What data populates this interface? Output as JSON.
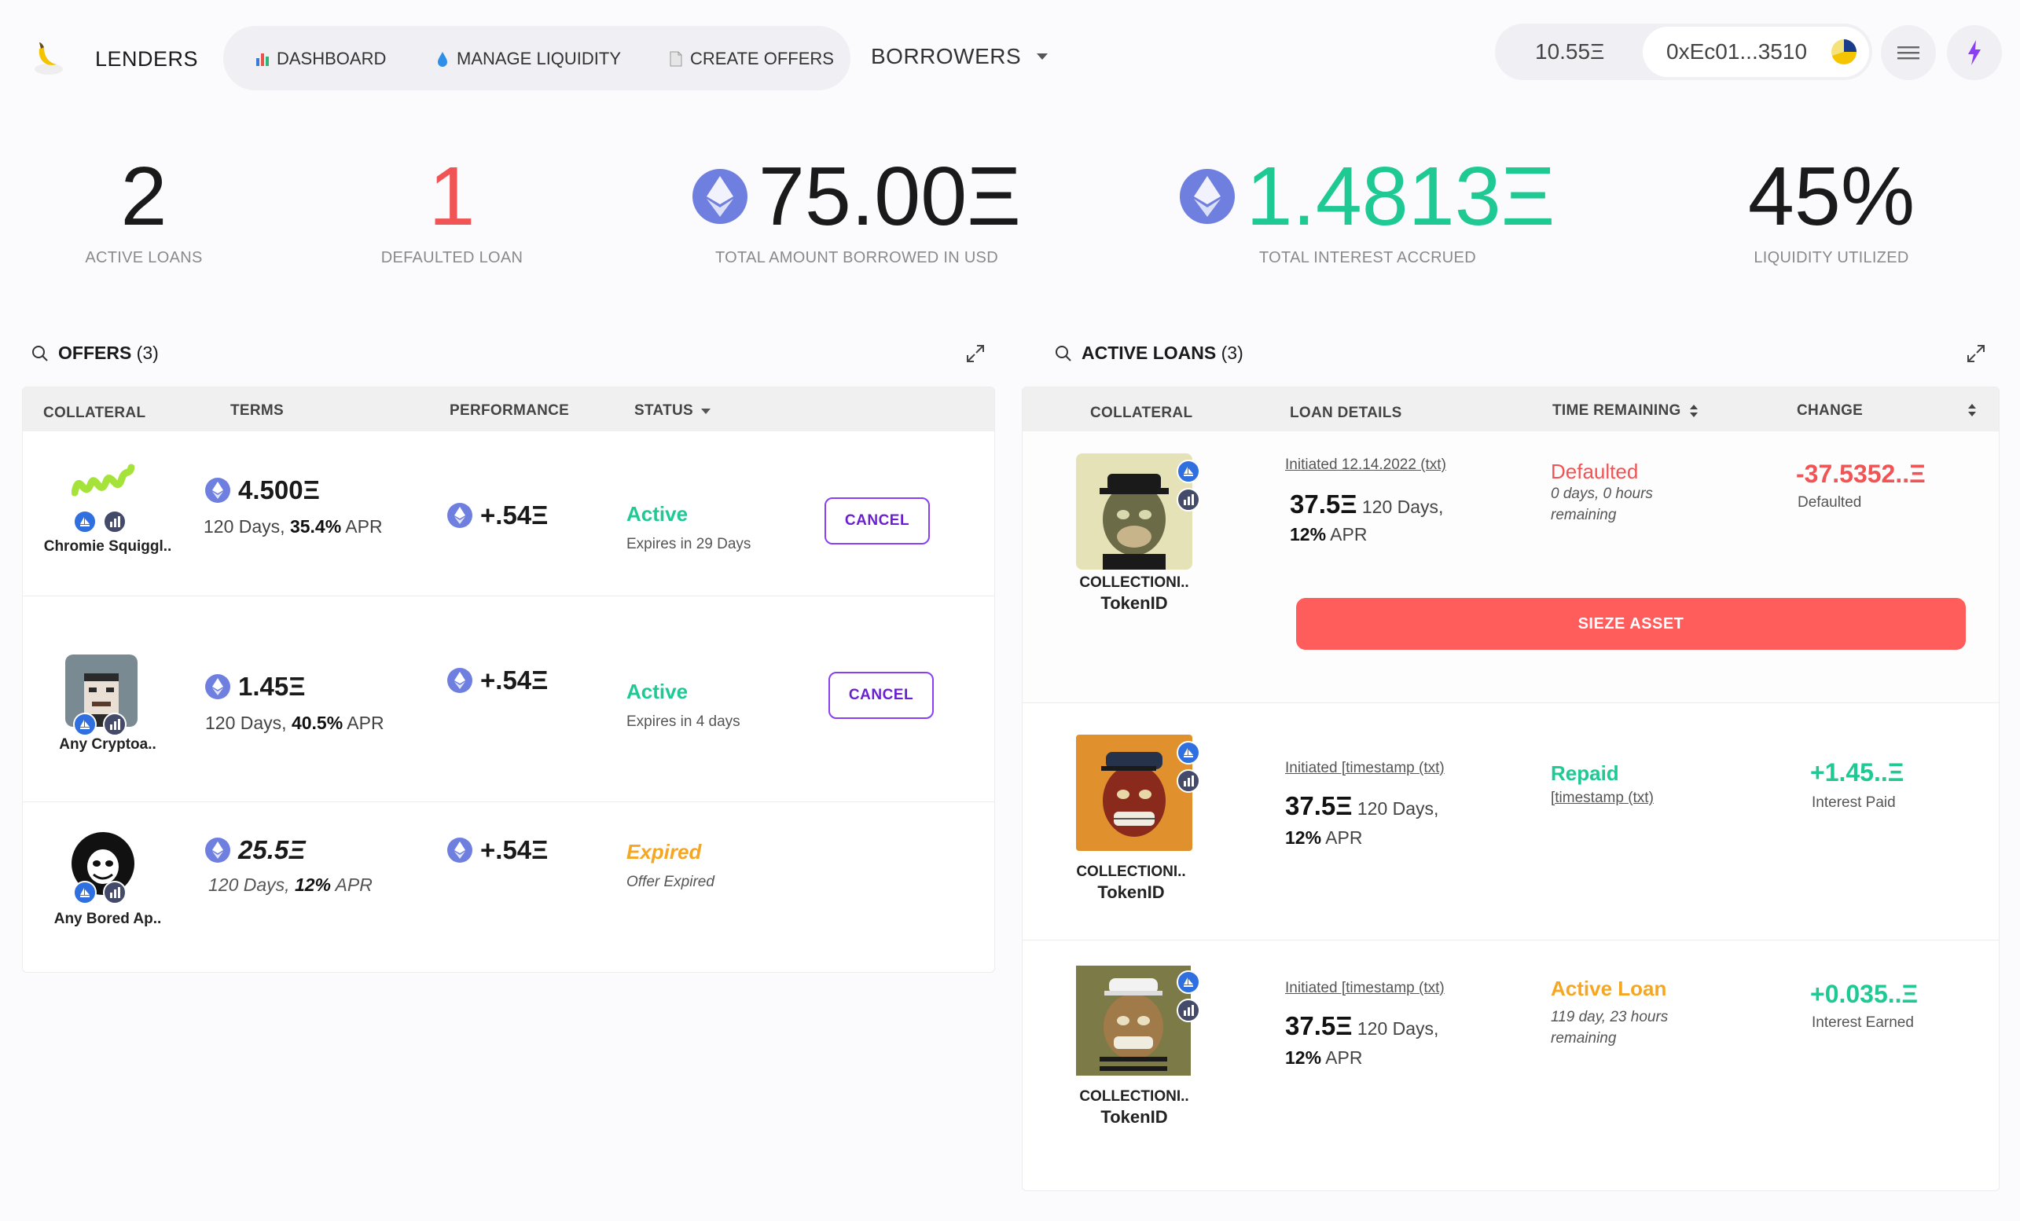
{
  "header": {
    "brand": "LENDERS",
    "nav": [
      {
        "label": "DASHBOARD",
        "icon": "bar-chart-icon"
      },
      {
        "label": "MANAGE LIQUIDITY",
        "icon": "droplet-icon"
      },
      {
        "label": "CREATE OFFERS",
        "icon": "document-icon"
      }
    ],
    "borrowers": "BORROWERS",
    "balance": "10.55Ξ",
    "address": "0xEc01...3510"
  },
  "stats": [
    {
      "value": "2",
      "label": "ACTIVE LOANS",
      "color": "#1a1a1a"
    },
    {
      "value": "1",
      "label": "DEFAULTED LOAN",
      "color": "#f05454"
    },
    {
      "value": "75.00Ξ",
      "label": "TOTAL AMOUNT BORROWED IN USD",
      "color": "#1a1a1a"
    },
    {
      "value": "1.4813Ξ",
      "label": "TOTAL INTEREST ACCRUED",
      "color": "#1ec994"
    },
    {
      "value": "45%",
      "label": "LIQUIDITY UTILIZED",
      "color": "#1a1a1a"
    }
  ],
  "offers": {
    "title": "OFFERS",
    "count": "(3)",
    "headers": [
      "COLLATERAL",
      "TERMS",
      "PERFORMANCE",
      "STATUS"
    ],
    "rows": [
      {
        "collateral": "Chromie Squiggl..",
        "amount": "4.500Ξ",
        "days": "120 Days, ",
        "apr": "35.4%",
        "apr_suffix": " APR",
        "performance": "+.54Ξ",
        "status": "Active",
        "status_sub": "Expires in 29 Days",
        "action": "CANCEL"
      },
      {
        "collateral": "Any Cryptoa..",
        "amount": "1.45Ξ",
        "days": "120 Days, ",
        "apr": "40.5%",
        "apr_suffix": " APR",
        "performance": "+.54Ξ",
        "status": "Active",
        "status_sub": "Expires in 4 days",
        "action": "CANCEL"
      },
      {
        "collateral": "Any Bored Ap..",
        "amount": "25.5Ξ",
        "days": "120 Days, ",
        "apr": "12%",
        "apr_suffix": " APR",
        "performance": "+.54Ξ",
        "status": "Expired",
        "status_sub": "Offer Expired"
      }
    ]
  },
  "loans": {
    "title": "ACTIVE LOANS",
    "count": "(3)",
    "headers": [
      "COLLATERAL",
      "LOAN DETAILS",
      "TIME REMAINING",
      "CHANGE"
    ],
    "rows": [
      {
        "collection": "COLLECTIONI..",
        "token": "TokenID",
        "initiated": "Initiated 12.14.2022 (txt)",
        "amount": "37.5Ξ",
        "days": " 120 Days,",
        "apr": "12%",
        "apr_suffix": " APR",
        "status": "Defaulted",
        "status_sub1": "0 days, 0 hours",
        "status_sub2": "remaining",
        "change": "-37.5352..Ξ",
        "change_label": "Defaulted",
        "action": "SIEZE ASSET"
      },
      {
        "collection": "COLLECTIONI..",
        "token": "TokenID",
        "initiated": "Initiated [timestamp (txt)",
        "amount": "37.5Ξ",
        "days": " 120 Days,",
        "apr": "12%",
        "apr_suffix": " APR",
        "status": "Repaid",
        "status_sub1": "[timestamp (txt)",
        "change": "+1.45..Ξ",
        "change_label": "Interest Paid"
      },
      {
        "collection": "COLLECTIONI..",
        "token": "TokenID",
        "initiated": "Initiated [timestamp (txt)",
        "amount": "37.5Ξ",
        "days": " 120 Days,",
        "apr": "12%",
        "apr_suffix": " APR",
        "status": "Active Loan",
        "status_sub1": "119 day, 23 hours",
        "status_sub2": "remaining",
        "change": "+0.035..Ξ",
        "change_label": "Interest Earned"
      }
    ]
  }
}
